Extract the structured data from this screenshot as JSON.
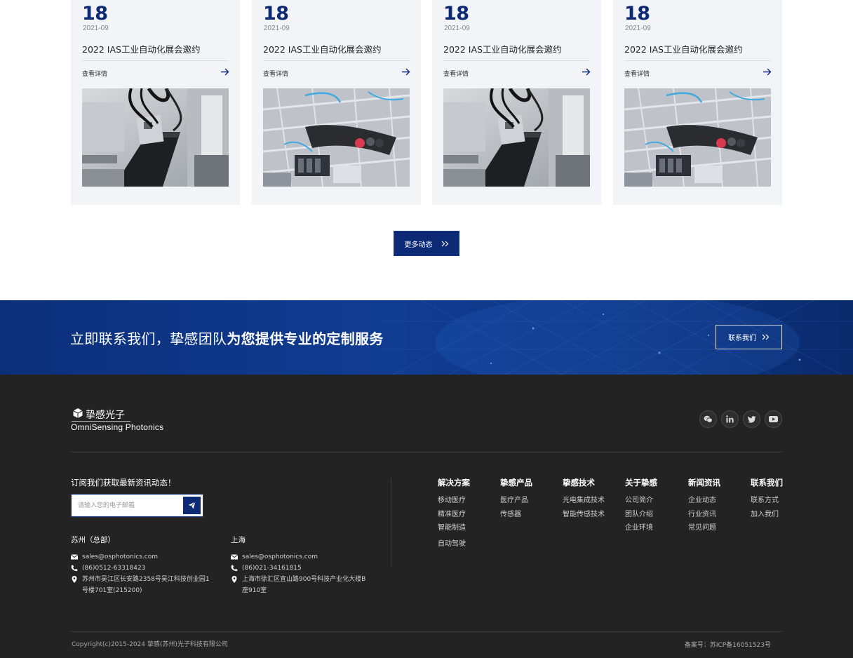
{
  "news": {
    "cards": [
      {
        "day": "18",
        "ym": "2021-09",
        "title": "2022 IAS工业自动化展会邀约",
        "more": "查看详情",
        "image": "robotic-arm-conveyor-photo"
      },
      {
        "day": "18",
        "ym": "2021-09",
        "title": "2022 IAS工业自动化展会邀约",
        "more": "查看详情",
        "image": "automation-assembly-line-photo"
      },
      {
        "day": "18",
        "ym": "2021-09",
        "title": "2022 IAS工业自动化展会邀约",
        "more": "查看详情",
        "image": "robotic-arm-conveyor-photo"
      },
      {
        "day": "18",
        "ym": "2021-09",
        "title": "2022 IAS工业自动化展会邀约",
        "more": "查看详情",
        "image": "automation-assembly-line-photo"
      }
    ],
    "more_button": "更多动态"
  },
  "banner": {
    "slogan_light": "立即联系我们，挚感团队",
    "slogan_bold": "为您提供专业的定制服务",
    "contact_button": "联系我们"
  },
  "footer": {
    "logo_cn": "挚感光子",
    "logo_en": "OmniSensing Photonics",
    "socials": [
      "wechat-icon",
      "linkedin-icon",
      "twitter-icon",
      "youtube-icon"
    ],
    "subscribe_title": "订阅我们获取最新资讯动态！",
    "subscribe_placeholder": "请输入您的电子邮箱",
    "offices": [
      {
        "name": "苏州（总部）",
        "email": "sales@osphotonics.com",
        "phone": "(86)0512-63318423",
        "address": "苏州市吴江区长安路2358号吴江科技创业园1号楼701室(215200)"
      },
      {
        "name": "上海",
        "email": "sales@osphotonics.com",
        "phone": "(86)021-34161815",
        "address": "上海市徐汇区宜山路900号科技产业化大楼B座910室"
      }
    ],
    "columns": [
      {
        "title": "解决方案",
        "links": [
          "移动医疗",
          "精准医疗",
          "智能制造",
          "自动驾驶"
        ]
      },
      {
        "title": "挚感产品",
        "links": [
          "医疗产品",
          "传感器"
        ]
      },
      {
        "title": "挚感技术",
        "links": [
          "光电集成技术",
          "智能传感技术"
        ]
      },
      {
        "title": "关于挚感",
        "links": [
          "公司简介",
          "团队介绍",
          "企业环境"
        ]
      },
      {
        "title": "新闻资讯",
        "links": [
          "企业动态",
          "行业资讯",
          "常见问题"
        ]
      },
      {
        "title": "联系我们",
        "links": [
          "联系方式",
          "加入我们"
        ]
      }
    ],
    "copyright": "Copyright(c)2015-2024 挚感(苏州)光子科技有限公司",
    "icp": "备案号：苏ICP备16051523号"
  },
  "colors": {
    "brand": "#0c2a75",
    "card_bg": "#f3f4f8",
    "footer_bg": "#232323"
  }
}
